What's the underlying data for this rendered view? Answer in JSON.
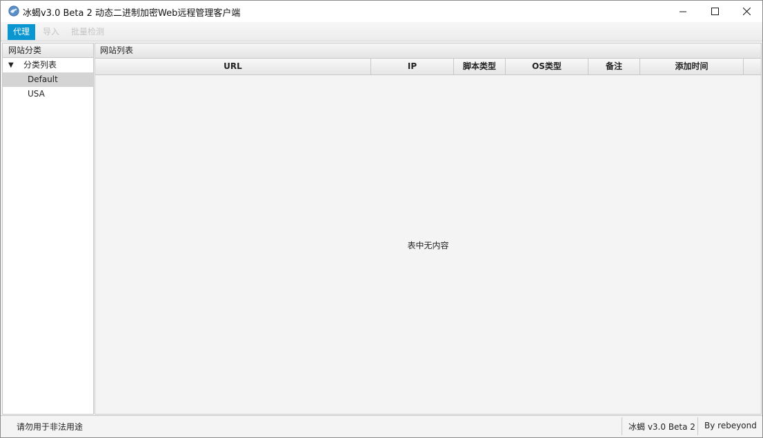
{
  "window": {
    "title": "冰蝎v3.0 Beta 2 动态二进制加密Web远程管理客户端"
  },
  "menu": {
    "items": [
      {
        "label": "代理",
        "state": "active"
      },
      {
        "label": "导入",
        "state": "disabled"
      },
      {
        "label": "批量检测",
        "state": "disabled"
      }
    ]
  },
  "left_panel": {
    "header": "网站分类",
    "tree": {
      "root_label": "分类列表",
      "children": [
        "Default",
        "USA"
      ],
      "selected": "Default"
    }
  },
  "right_panel": {
    "header": "网站列表",
    "columns": [
      "URL",
      "IP",
      "脚本类型",
      "OS类型",
      "备注",
      "添加时间"
    ],
    "empty_message": "表中无内容"
  },
  "status_bar": {
    "left": "请勿用于非法用途",
    "version": "冰蝎 v3.0 Beta 2",
    "author": "By rebeyond"
  },
  "colors": {
    "accent": "#0a96d1",
    "background": "#f4f4f4",
    "border": "#c8c8c8",
    "selected_row": "#d4d4d4"
  }
}
